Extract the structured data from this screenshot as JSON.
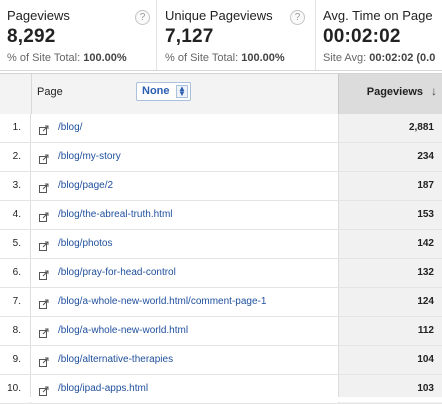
{
  "metrics": [
    {
      "title": "Pageviews",
      "value": "8,292",
      "sub_label": "% of Site Total:",
      "sub_value": "100.00%",
      "help": "?"
    },
    {
      "title": "Unique Pageviews",
      "value": "7,127",
      "sub_label": "% of Site Total:",
      "sub_value": "100.00%",
      "help": "?"
    },
    {
      "title": "Avg. Time on Page",
      "value": "00:02:02",
      "sub_label": "Site Avg:",
      "sub_value": "00:02:02 (0.0",
      "help": ""
    }
  ],
  "table": {
    "page_header": "Page",
    "secondary_dimension": "None",
    "pageviews_header": "Pageviews",
    "rows": [
      {
        "idx": "1.",
        "page": "/blog/",
        "pageviews": "2,881"
      },
      {
        "idx": "2.",
        "page": "/blog/my-story",
        "pageviews": "234"
      },
      {
        "idx": "3.",
        "page": "/blog/page/2",
        "pageviews": "187"
      },
      {
        "idx": "4.",
        "page": "/blog/the-abreal-truth.html",
        "pageviews": "153"
      },
      {
        "idx": "5.",
        "page": "/blog/photos",
        "pageviews": "142"
      },
      {
        "idx": "6.",
        "page": "/blog/pray-for-head-control",
        "pageviews": "132"
      },
      {
        "idx": "7.",
        "page": "/blog/a-whole-new-world.html/comment-page-1",
        "pageviews": "124"
      },
      {
        "idx": "8.",
        "page": "/blog/a-whole-new-world.html",
        "pageviews": "112"
      },
      {
        "idx": "9.",
        "page": "/blog/alternative-therapies",
        "pageviews": "104"
      },
      {
        "idx": "10.",
        "page": "/blog/ipad-apps.html",
        "pageviews": "103"
      }
    ]
  },
  "colors": {
    "link": "#1f4f9c",
    "accent": "#2a5db0"
  }
}
